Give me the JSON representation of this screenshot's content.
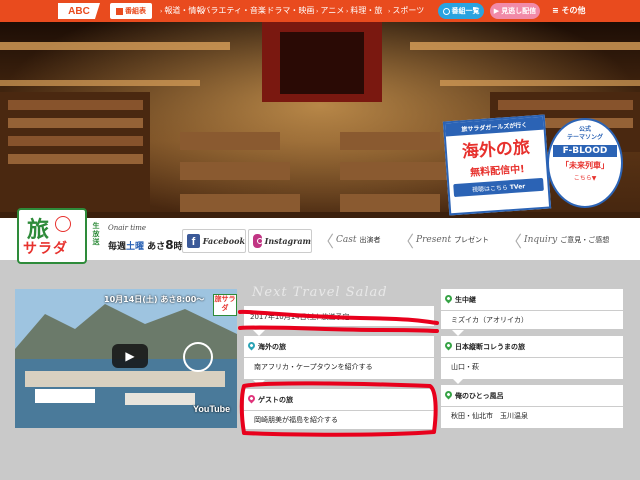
{
  "nav": {
    "logo": "ABC",
    "schedule_badge": "番組表",
    "items": [
      "報道・情報",
      "バラエティ・音楽",
      "ドラマ・映画",
      "アニメ",
      "料理・旅",
      "スポーツ"
    ],
    "program_list": "番組一覧",
    "missed": "見逃し配信",
    "other": "その他"
  },
  "promo_tver": {
    "line1": "旅サラダガールズが行く",
    "line2": "海外の旅",
    "line3": "無料配信中!",
    "line4": "視聴はこちら",
    "tver": "TVer"
  },
  "promo_song": {
    "line1": "公式",
    "line2": "テーマソング",
    "band": "F-BLOOD",
    "title": "「未来列車」",
    "link": "こちら▼"
  },
  "show": {
    "logo_top": "旅",
    "logo_bottom": "サラダ",
    "live": "生放送",
    "onair_label": "Onair time",
    "weekly": "毎週",
    "day": "土曜",
    "morning": "あさ",
    "hour": "8",
    "hour_suffix": "時"
  },
  "social": {
    "facebook": "Facebook",
    "instagram": "Instagram"
  },
  "links": [
    {
      "en": "Cast",
      "jp": "出演者"
    },
    {
      "en": "Present",
      "jp": "プレゼント"
    },
    {
      "en": "Inquiry",
      "jp": "ご意見・ご感想"
    }
  ],
  "video": {
    "banner": "10月14日(土) あさ8:00〜",
    "mini_logo": "旅サラダ",
    "youtube": "YouTube"
  },
  "section_title": "Next Travel Salad",
  "broadcast_date": "2017年10月14日(土) 放送予定",
  "segments": {
    "overseas": {
      "title": "海外の旅",
      "body": "南アフリカ・ケープタウンを紹介する"
    },
    "guest": {
      "title": "ゲストの旅",
      "body": "岡崎朋美が福島を紹介する"
    },
    "live": {
      "title": "生中継",
      "body": "ミズイカ（アオリイカ）"
    },
    "korekara": {
      "title": "日本縦断コレうまの旅",
      "body": "山口・萩"
    },
    "onsen": {
      "title": "俺のひとっ風呂",
      "body": "秋田・仙北市　玉川温泉"
    }
  },
  "colors": {
    "brand": "#e94b1e",
    "green": "#2e8b3a",
    "teal_pin": "#2aa3b5",
    "pink_pin": "#e0337a",
    "green_pin": "#36a345",
    "red_mark": "#e8001c"
  }
}
